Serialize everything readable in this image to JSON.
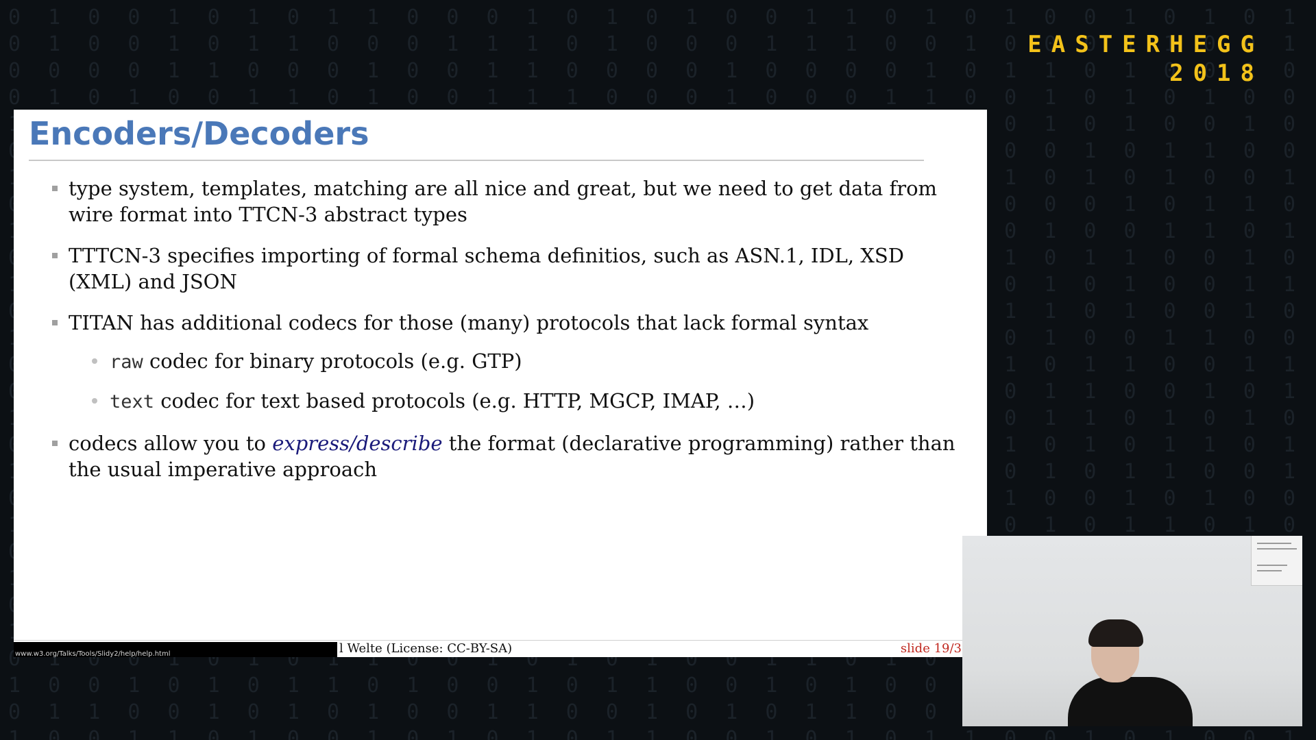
{
  "brand": {
    "line1": "EASTERHEGG",
    "line2": "2018"
  },
  "slide": {
    "title": "Encoders/Decoders",
    "bullets": [
      {
        "text": "type system, templates, matching are all nice and great, but we need to get data from wire format into TTCN-3 abstract types"
      },
      {
        "text": "TTTCN-3 specifies importing of formal schema definitios, such as ASN.1, IDL, XSD (XML) and JSON"
      },
      {
        "text": "TITAN has additional codecs for those (many) protocols that lack formal syntax",
        "sub": [
          {
            "code": "raw",
            "text": " codec for binary protocols (e.g. GTP)"
          },
          {
            "code": "text",
            "text": " codec for text based protocols (e.g. HTTP, MGCP, IMAP, …)"
          }
        ]
      },
      {
        "before": "codecs allow you to ",
        "emph": "express/describe",
        "after": " the format (declarative programming) rather than the usual imperative approach"
      }
    ],
    "footer": {
      "text": "l Welte (License: CC-BY-SA)",
      "status_url": "www.w3.org/Talks/Tools/Slidy2/help/help.html",
      "slide_number": "slide 19/3"
    }
  },
  "colors": {
    "title": "#4a78b8",
    "brand": "#f3c21a",
    "slide_number": "#c0281f",
    "emphasis": "#1a1a7a"
  }
}
